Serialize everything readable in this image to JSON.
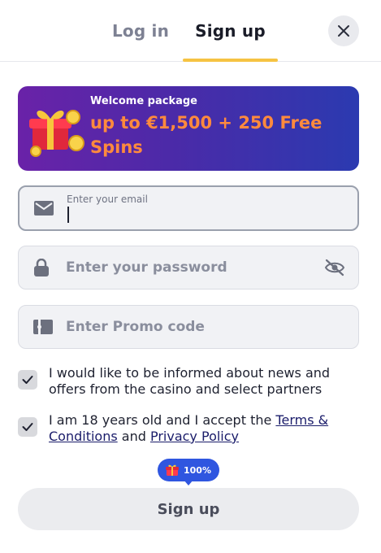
{
  "tabs": {
    "login": "Log in",
    "signup": "Sign up",
    "active": "signup"
  },
  "banner": {
    "kicker": "Welcome package",
    "title": "up to €1,500 + 250 Free Spins"
  },
  "form": {
    "email": {
      "label": "Enter your email",
      "value": ""
    },
    "password": {
      "placeholder": "Enter your password"
    },
    "promo": {
      "placeholder": "Enter Promo code"
    }
  },
  "consents": {
    "news": {
      "text": "I would like to be informed about news and offers from the casino and select partners",
      "checked": true
    },
    "terms": {
      "prefix": "I am 18 years old and I accept the ",
      "terms_link": "Terms & Conditions",
      "and": " and ",
      "privacy_link": "Privacy Policy",
      "checked": true
    }
  },
  "bonus_pill": {
    "label": "100%"
  },
  "submit": {
    "label": "Sign up"
  },
  "colors": {
    "accent_underline": "#f6c343",
    "banner_gradient_start": "#6a22a8",
    "banner_gradient_end": "#2b3ab0",
    "banner_title": "#ff8a3d",
    "pill": "#2f56e0"
  },
  "icons": [
    "close-icon",
    "gift-icon",
    "mail-icon",
    "lock-icon",
    "eye-off-icon",
    "promo-card-icon",
    "checkmark-icon"
  ]
}
